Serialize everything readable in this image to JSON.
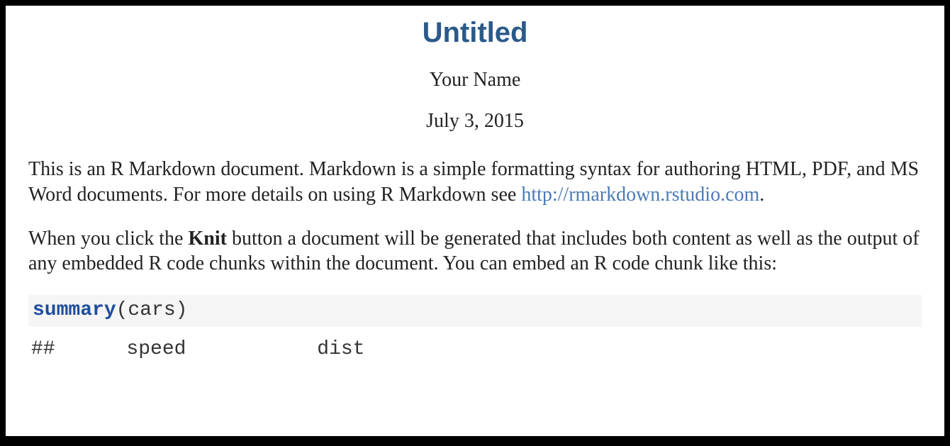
{
  "header": {
    "title": "Untitled",
    "author": "Your Name",
    "date": "July 3, 2015"
  },
  "paragraph1": {
    "text_before_link": "This is an R Markdown document. Markdown is a simple formatting syntax for authoring HTML, PDF, and MS Word documents. For more details on using R Markdown see ",
    "link_text": "http://rmarkdown.rstudio.com",
    "text_after_link": "."
  },
  "paragraph2": {
    "text_before_bold": "When you click the ",
    "bold_text": "Knit",
    "text_after_bold": " button a document will be generated that includes both content as well as the output of any embedded R code chunks within the document. You can embed an R code chunk like this:"
  },
  "code": {
    "func": "summary",
    "rest": "(cars)"
  },
  "output": {
    "line1": "##      speed           dist"
  }
}
